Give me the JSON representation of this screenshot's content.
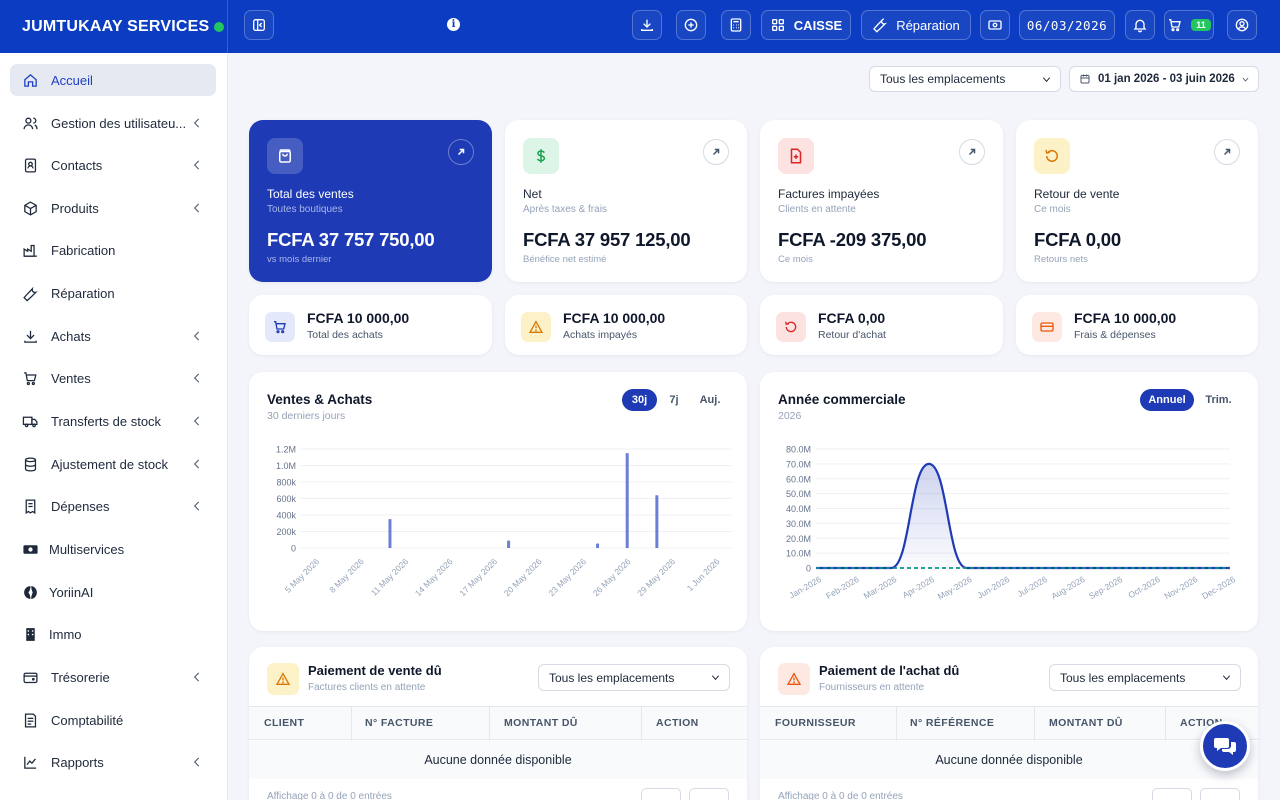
{
  "app": {
    "brand": "JUMTUKAAY SERVICES",
    "accent": "#0b3cc1",
    "primary_card": "#1e3ab4",
    "online_status": "#22c55e"
  },
  "topbar": {
    "caisse_label": "CAISSE",
    "reparation_label": "Réparation",
    "date": "06/03/2026",
    "cart_count": "11"
  },
  "sidebar": {
    "items": [
      {
        "label": "Accueil",
        "icon": "home-icon",
        "active": true
      },
      {
        "label": "Gestion des utilisateu...",
        "icon": "users-icon",
        "expandable": true
      },
      {
        "label": "Contacts",
        "icon": "contact-book-icon",
        "expandable": true
      },
      {
        "label": "Produits",
        "icon": "box-icon",
        "expandable": true
      },
      {
        "label": "Fabrication",
        "icon": "factory-icon"
      },
      {
        "label": "Réparation",
        "icon": "wrench-icon"
      },
      {
        "label": "Achats",
        "icon": "download-icon",
        "expandable": true
      },
      {
        "label": "Ventes",
        "icon": "cart-icon",
        "expandable": true
      },
      {
        "label": "Transferts de stock",
        "icon": "truck-icon",
        "expandable": true
      },
      {
        "label": "Ajustement de stock",
        "icon": "database-icon",
        "expandable": true
      },
      {
        "label": "Dépenses",
        "icon": "receipt-icon",
        "expandable": true
      },
      {
        "label": "Multiservices",
        "icon": "money-icon"
      },
      {
        "label": "YoriinAI",
        "icon": "ai-leaf-icon"
      },
      {
        "label": "Immo",
        "icon": "building-icon"
      },
      {
        "label": "Trésorerie",
        "icon": "wallet-icon",
        "expandable": true
      },
      {
        "label": "Comptabilité",
        "icon": "ledger-icon"
      },
      {
        "label": "Rapports",
        "icon": "chart-icon",
        "expandable": true
      }
    ]
  },
  "filters": {
    "location": "Tous les emplacements",
    "date_range": "01 jan 2026 - 03 juin 2026"
  },
  "kpis": [
    {
      "title": "Total des ventes",
      "sub": "Toutes boutiques",
      "value": "FCFA 37 757 750,00",
      "foot": "vs mois dernier",
      "icon": "shopping-bag-icon"
    },
    {
      "title": "Net",
      "sub": "Après taxes & frais",
      "value": "FCFA 37 957 125,00",
      "foot": "Bénéfice net estimé",
      "icon": "dollar-icon"
    },
    {
      "title": "Factures impayées",
      "sub": "Clients en attente",
      "value": "FCFA -209 375,00",
      "foot": "Ce mois",
      "icon": "invoice-icon"
    },
    {
      "title": "Retour de vente",
      "sub": "Ce mois",
      "value": "FCFA 0,00",
      "foot": "Retours nets",
      "icon": "undo-icon"
    }
  ],
  "minis": [
    {
      "value": "FCFA 10 000,00",
      "label": "Total des achats",
      "icon": "cart-icon"
    },
    {
      "value": "FCFA 10 000,00",
      "label": "Achats impayés",
      "icon": "warning-icon"
    },
    {
      "value": "FCFA 0,00",
      "label": "Retour d'achat",
      "icon": "undo-icon"
    },
    {
      "value": "FCFA 10 000,00",
      "label": "Frais & dépenses",
      "icon": "credit-card-icon"
    }
  ],
  "sales_chart": {
    "title": "Ventes & Achats",
    "subtitle": "30 derniers jours",
    "tabs": [
      "30j",
      "7j",
      "Auj."
    ],
    "active_tab": "30j"
  },
  "year_chart": {
    "title": "Année commerciale",
    "subtitle": "2026",
    "tabs": [
      "Annuel",
      "Trim."
    ],
    "active_tab": "Annuel"
  },
  "chart_data": [
    {
      "type": "bar",
      "title": "Ventes & Achats",
      "y_ticks": [
        "0",
        "200k",
        "400k",
        "600k",
        "800k",
        "1.0M",
        "1.2M"
      ],
      "ylim": [
        0,
        1200000
      ],
      "x_ticks": [
        "5 May 2026",
        "8 May 2026",
        "11 May 2026",
        "14 May 2026",
        "17 May 2026",
        "20 May 2026",
        "23 May 2026",
        "26 May 2026",
        "29 May 2026",
        "1 Jun 2026"
      ],
      "x_range": [
        "4 May 2026",
        "2 Jun 2026"
      ],
      "series": [
        {
          "color": "#6b7fd7",
          "points": [
            {
              "x": "10 May 2026",
              "y": 350000
            },
            {
              "x": "18 May 2026",
              "y": 90000
            },
            {
              "x": "24 May 2026",
              "y": 55000
            },
            {
              "x": "26 May 2026",
              "y": 1150000
            },
            {
              "x": "28 May 2026",
              "y": 640000
            }
          ]
        }
      ],
      "grid": true
    },
    {
      "type": "area",
      "title": "Année commerciale",
      "categories": [
        "Jan-2026",
        "Feb-2026",
        "Mar-2026",
        "Apr-2026",
        "May-2026",
        "Jun-2026",
        "Jul-2026",
        "Aug-2026",
        "Sep-2026",
        "Oct-2026",
        "Nov-2026",
        "Dec-2026"
      ],
      "y_ticks": [
        "0",
        "10.0M",
        "20.0M",
        "30.0M",
        "40.0M",
        "50.0M",
        "60.0M",
        "70.0M",
        "80.0M"
      ],
      "ylim": [
        0,
        80000000
      ],
      "series": [
        {
          "color": "#1e3ab4",
          "values": [
            0,
            0,
            0,
            70000000,
            0,
            0,
            0,
            0,
            0,
            0,
            0,
            0
          ]
        },
        {
          "color": "#0d9488",
          "style": "dashed",
          "values": [
            0,
            0,
            0,
            10000,
            0,
            0,
            0,
            0,
            0,
            0,
            0,
            0
          ]
        }
      ],
      "grid": true
    }
  ],
  "sales_due": {
    "title": "Paiement de vente dû",
    "subtitle": "Factures clients en attente",
    "location": "Tous les emplacements",
    "columns": [
      "CLIENT",
      "N° FACTURE",
      "MONTANT DÛ",
      "ACTION"
    ],
    "empty": "Aucune donnée disponible",
    "footer": "Affichage 0 à 0 de 0 entrées"
  },
  "purchase_due": {
    "title": "Paiement de l'achat dû",
    "subtitle": "Fournisseurs en attente",
    "location": "Tous les emplacements",
    "columns": [
      "FOURNISSEUR",
      "N° RÉFÉRENCE",
      "MONTANT DÛ",
      "ACTION"
    ],
    "empty": "Aucune donnée disponible",
    "footer": "Affichage 0 à 0 de 0 entrées"
  }
}
